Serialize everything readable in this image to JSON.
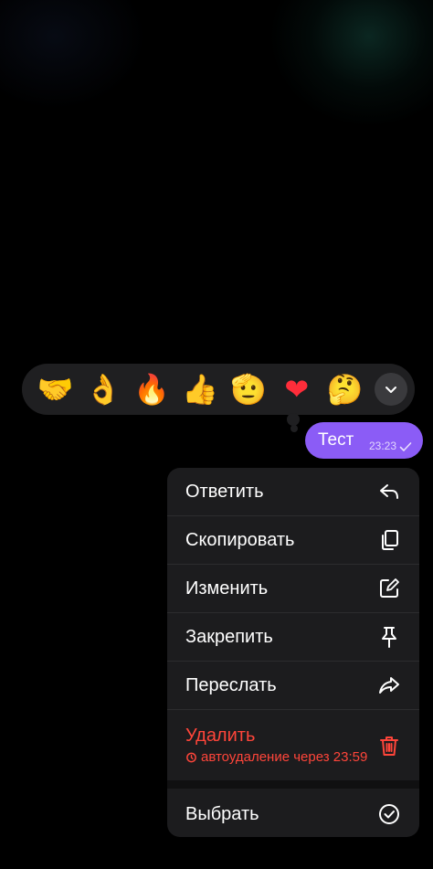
{
  "reactions": {
    "items": [
      "🤝",
      "👌",
      "🔥",
      "👍",
      "🫡",
      "❤",
      "🤔"
    ],
    "expand_icon": "chevron-down-icon"
  },
  "message": {
    "text": "Тест",
    "time": "23:23",
    "status_icon": "check-icon",
    "bubble_color": "#8b5cf6"
  },
  "menu": {
    "reply": "Ответить",
    "copy": "Скопировать",
    "edit": "Изменить",
    "pin": "Закрепить",
    "forward": "Переслать",
    "delete": "Удалить",
    "delete_sub": "автоудаление через 23:59",
    "select": "Выбрать"
  },
  "colors": {
    "danger": "#ff453a",
    "menu_bg": "#1c1c1e",
    "reaction_bar_bg": "#1f1f21"
  }
}
